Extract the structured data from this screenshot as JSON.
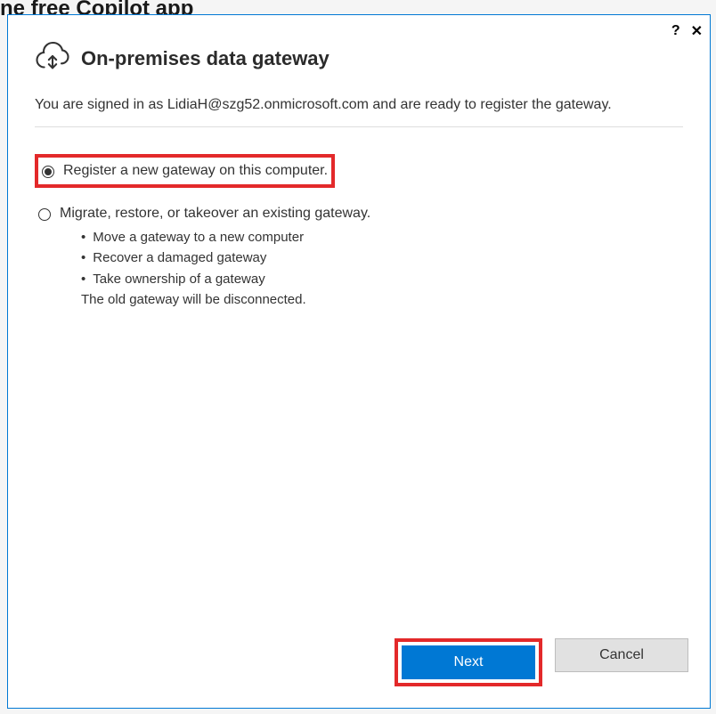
{
  "background_peek": "ne free Copilot app",
  "dialog": {
    "title": "On-premises data gateway",
    "signin_message": "You are signed in as LidiaH@szg52.onmicrosoft.com and are ready to register the gateway.",
    "options": {
      "register": "Register a new gateway on this computer.",
      "migrate": "Migrate, restore, or takeover an existing gateway.",
      "migrate_bullets": {
        "b1": "Move a gateway to a new computer",
        "b2": "Recover a damaged gateway",
        "b3": "Take ownership of a gateway"
      },
      "migrate_note": "The old gateway will be disconnected."
    },
    "buttons": {
      "next": "Next",
      "cancel": "Cancel"
    },
    "help_label": "?",
    "close_label": "✕"
  }
}
